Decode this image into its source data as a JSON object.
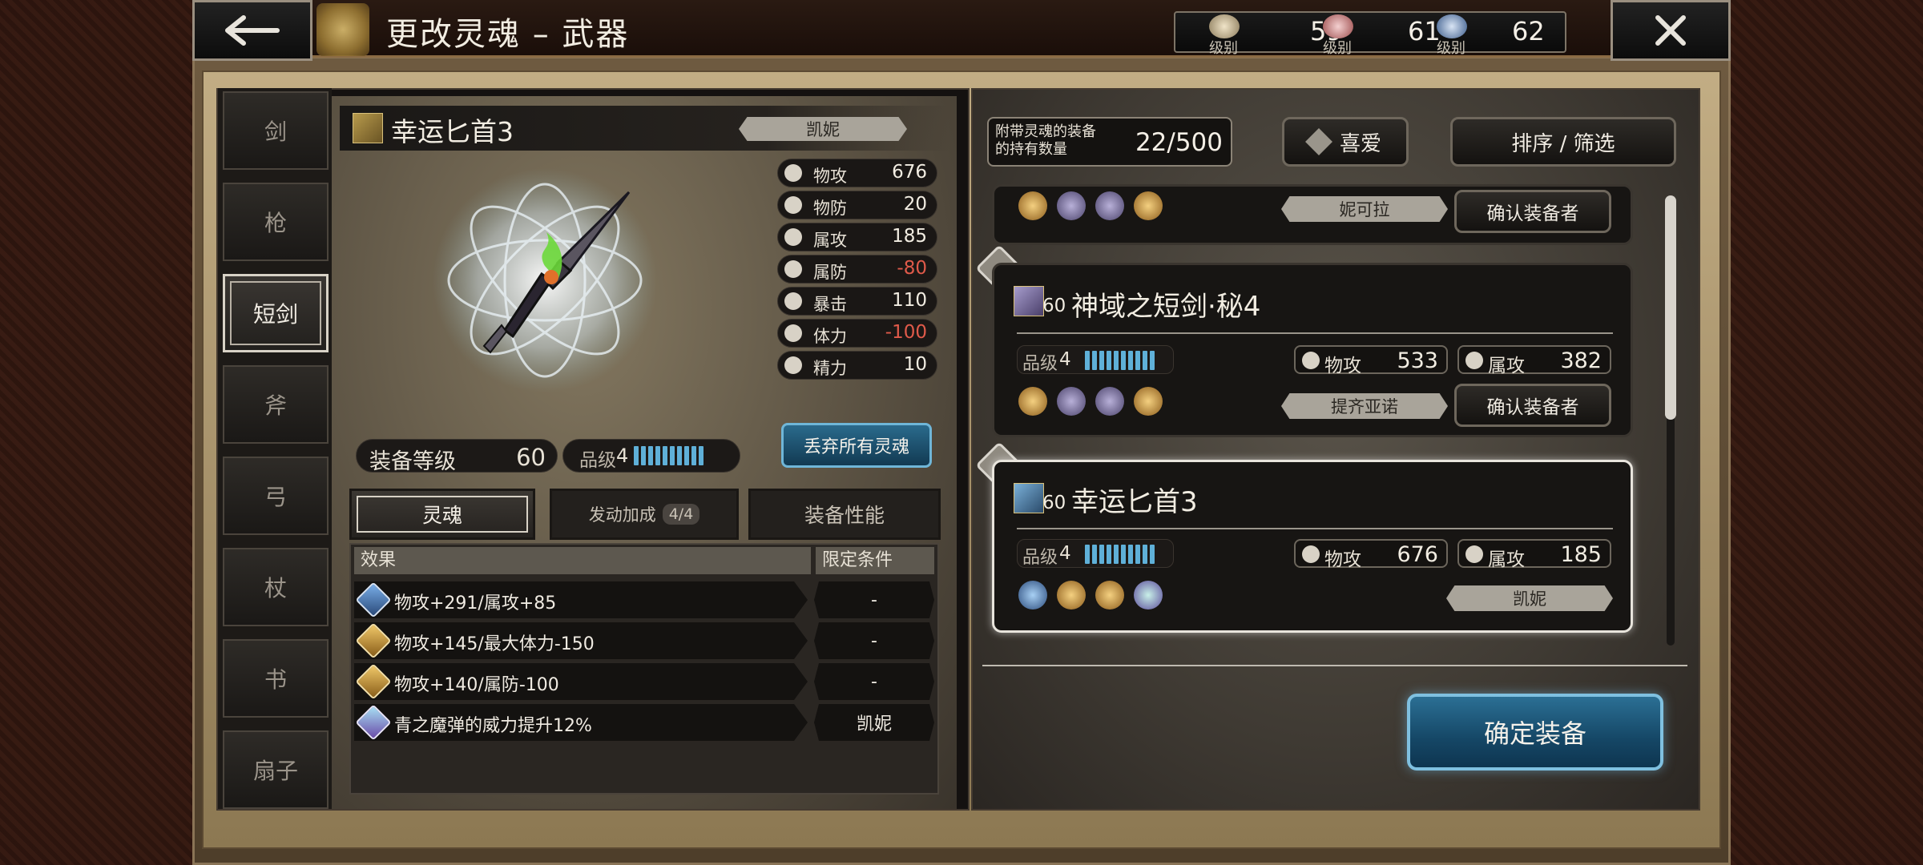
{
  "header": {
    "title": "更改灵魂 – 武器",
    "levels": [
      {
        "value": "59",
        "label": "级别"
      },
      {
        "value": "61",
        "label": "级别"
      },
      {
        "value": "62",
        "label": "级别"
      }
    ]
  },
  "categories": [
    "剑",
    "枪",
    "短剑",
    "斧",
    "弓",
    "杖",
    "书",
    "扇子"
  ],
  "item": {
    "name": "幸运匕首3",
    "owner": "凯妮",
    "stats": [
      {
        "name": "物攻",
        "value": "676"
      },
      {
        "name": "物防",
        "value": "20"
      },
      {
        "name": "属攻",
        "value": "185"
      },
      {
        "name": "属防",
        "value": "-80"
      },
      {
        "name": "暴击",
        "value": "110"
      },
      {
        "name": "体力",
        "value": "-100"
      },
      {
        "name": "精力",
        "value": "10"
      }
    ],
    "equip_level_label": "装备等级",
    "equip_level": "60",
    "grade_label": "品级",
    "grade": "4",
    "discard_label": "丢弃所有灵魂"
  },
  "tabs": {
    "soul": "灵魂",
    "bonus": "发动加成",
    "bonus_count": "4/4",
    "perf": "装备性能"
  },
  "table": {
    "col_effect": "效果",
    "col_cond": "限定条件",
    "rows": [
      {
        "effect": "物攻+291/属攻+85",
        "cond": "-"
      },
      {
        "effect": "物攻+145/最大体力-150",
        "cond": "-"
      },
      {
        "effect": "物攻+140/属防-100",
        "cond": "-"
      },
      {
        "effect": "青之魔弹的威力提升12%",
        "cond": "凯妮"
      }
    ]
  },
  "right": {
    "count_label": "附带灵魂的装备\n的持有数量",
    "count": "22/500",
    "fav_label": "喜爱",
    "sort_label": "排序 / 筛选",
    "cards": [
      {
        "owner": "妮可拉",
        "confirm": "确认装备者"
      },
      {
        "level": "60",
        "name": "神域之短剑·秘4",
        "grade_label": "品级",
        "grade": "4",
        "stat1_name": "物攻",
        "stat1": "533",
        "stat2_name": "属攻",
        "stat2": "382",
        "owner": "提齐亚诺",
        "confirm": "确认装备者"
      },
      {
        "level": "60",
        "name": "幸运匕首3",
        "grade_label": "品级",
        "grade": "4",
        "stat1_name": "物攻",
        "stat1": "676",
        "stat2_name": "属攻",
        "stat2": "185",
        "owner": "凯妮"
      }
    ],
    "confirm_equip": "确定装备"
  }
}
